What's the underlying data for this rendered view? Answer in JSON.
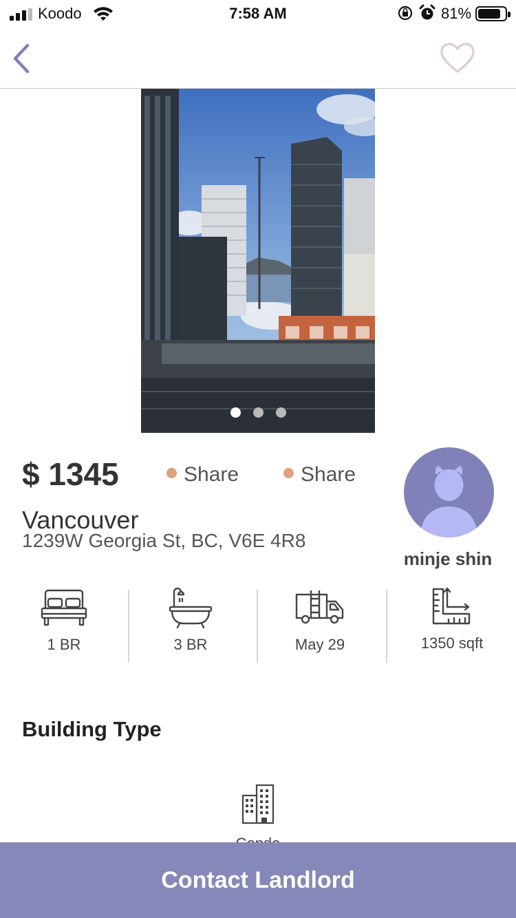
{
  "status_bar": {
    "carrier": "Koodo",
    "time": "7:58 AM",
    "battery_percent": "81%",
    "battery_level": 0.81
  },
  "nav": {
    "back_icon": "chevron-left-icon",
    "favorite_icon": "heart-outline-icon",
    "accent_color": "#8081b8",
    "heart_color": "#e3cfcf"
  },
  "gallery": {
    "photo_count": 3,
    "active_index": 0
  },
  "listing": {
    "price": "$ 1345",
    "tags": [
      "Share",
      "Share"
    ],
    "city": "Vancouver",
    "address": "1239W Georgia St, BC, V6E 4R8",
    "tag_bullet_color": "#dba27d"
  },
  "landlord": {
    "name": "minje shin",
    "avatar_bg": "#8081b8",
    "avatar_fg": "#b4b8f4"
  },
  "features": [
    {
      "icon": "bed-icon",
      "label": "1 BR"
    },
    {
      "icon": "bathtub-icon",
      "label": "3 BR"
    },
    {
      "icon": "moving-truck-icon",
      "label": "May 29"
    },
    {
      "icon": "area-ruler-icon",
      "label": "1350 sqft"
    }
  ],
  "building": {
    "title": "Building Type",
    "type_icon": "building-icon",
    "type_label": "Condo"
  },
  "cta": {
    "label": "Contact Landlord",
    "color": "#8588b8"
  }
}
